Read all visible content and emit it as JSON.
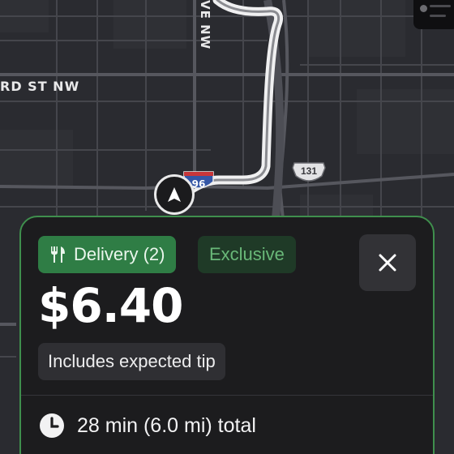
{
  "map": {
    "street_horizontal": "RD ST NW",
    "street_vertical": "VE NW",
    "us_route_shield": "131",
    "interstate_shield": "96",
    "colors": {
      "background": "#2a2b30",
      "roads": "#494a50",
      "route": "#e9e9ea",
      "accent": "#3f8f4d"
    }
  },
  "navigation": {
    "icon": "navigation-arrow-icon"
  },
  "offer_card": {
    "delivery_badge": "Delivery (2)",
    "delivery_icon": "fork-knife-icon",
    "exclusive_badge": "Exclusive",
    "close_icon": "close-icon",
    "price": "$6.40",
    "tip_note": "Includes expected tip",
    "eta_icon": "clock-icon",
    "eta": "28 min (6.0 mi) total"
  }
}
